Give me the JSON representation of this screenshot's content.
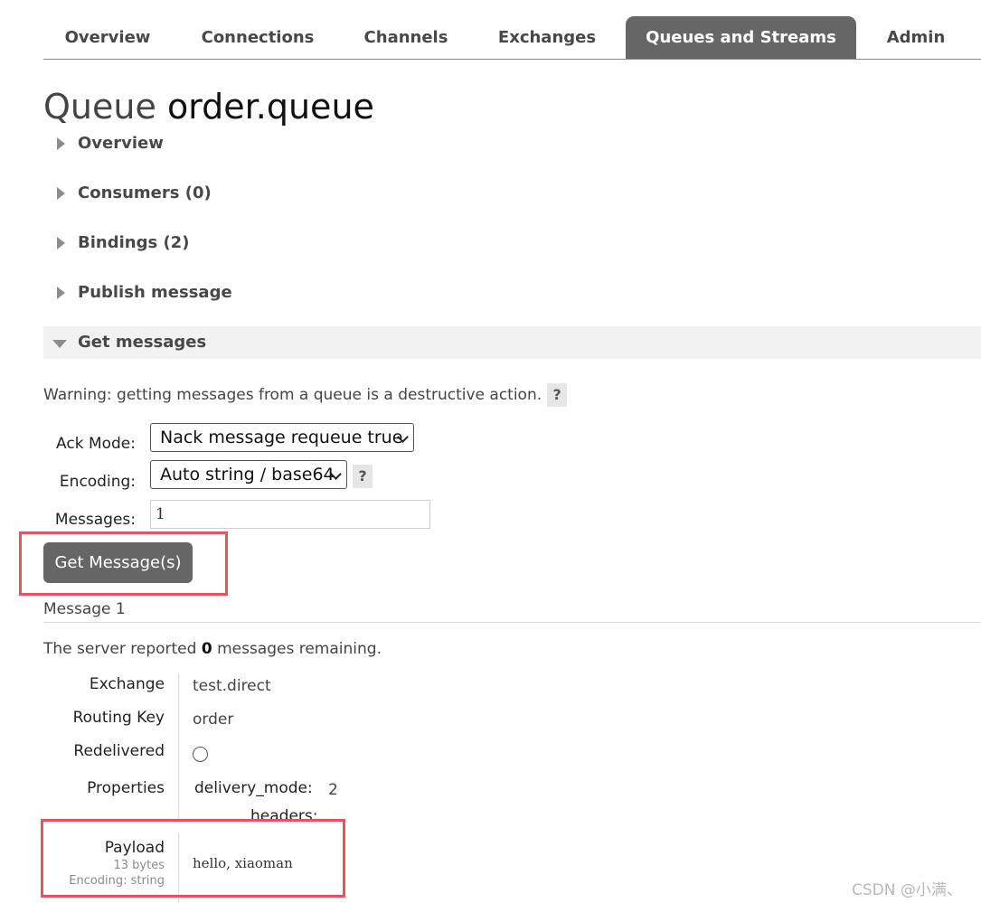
{
  "nav": {
    "tabs": [
      {
        "label": "Overview"
      },
      {
        "label": "Connections"
      },
      {
        "label": "Channels"
      },
      {
        "label": "Exchanges"
      },
      {
        "label": "Queues and Streams"
      },
      {
        "label": "Admin"
      }
    ],
    "active": "Queues and Streams"
  },
  "page": {
    "title_prefix": "Queue",
    "queue_name": "order.queue"
  },
  "sections": [
    {
      "label": "Overview",
      "expanded": false
    },
    {
      "label": "Consumers (0)",
      "expanded": false
    },
    {
      "label": "Bindings (2)",
      "expanded": false
    },
    {
      "label": "Publish message",
      "expanded": false
    },
    {
      "label": "Get messages",
      "expanded": true
    }
  ],
  "get_messages": {
    "warning": "Warning: getting messages from a queue is a destructive action.",
    "help_label": "?",
    "ack_mode_label": "Ack Mode:",
    "ack_mode_value": "Nack message requeue true",
    "encoding_label": "Encoding:",
    "encoding_value": "Auto string / base64",
    "messages_label": "Messages:",
    "messages_value": "1",
    "button_label": "Get Message(s)"
  },
  "message": {
    "header": "Message 1",
    "remaining_prefix": "The server reported ",
    "remaining_count": "0",
    "remaining_suffix": " messages remaining.",
    "exchange_label": "Exchange",
    "exchange_value": "test.direct",
    "routing_key_label": "Routing Key",
    "routing_key_value": "order",
    "redelivered_label": "Redelivered",
    "redelivered": false,
    "properties_label": "Properties",
    "delivery_mode_key": "delivery_mode:",
    "delivery_mode_value": "2",
    "headers_key": "headers:",
    "payload_label": "Payload",
    "payload_size": "13 bytes",
    "payload_encoding": "Encoding: string",
    "payload_value": "hello, xiaoman"
  },
  "watermark": "CSDN @小满、",
  "colors": {
    "active_tab": "#666666",
    "button": "#666666",
    "highlight": "#e8545a"
  }
}
